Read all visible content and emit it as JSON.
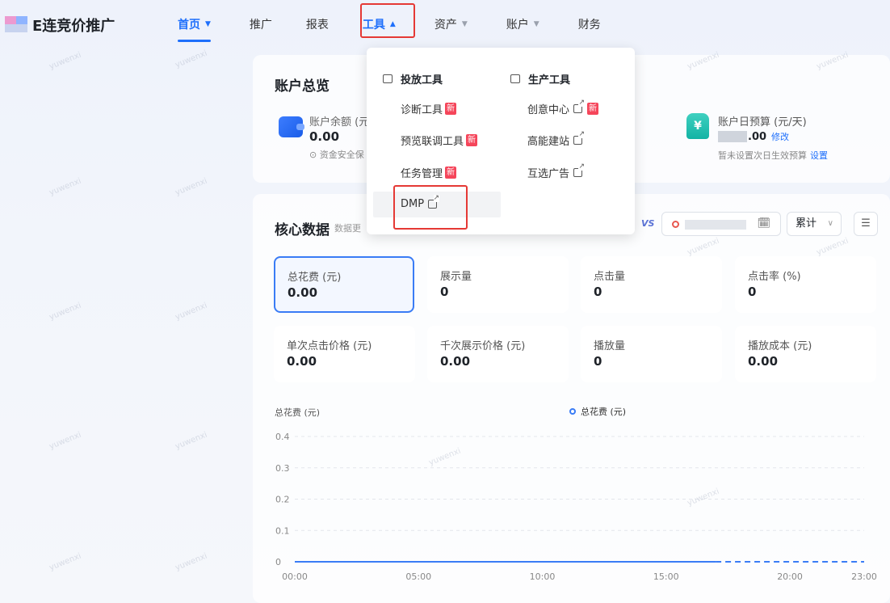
{
  "app": {
    "brand": "E连竞价推广"
  },
  "nav": {
    "items": [
      {
        "label": "首页",
        "caret": "▼"
      },
      {
        "label": "推广"
      },
      {
        "label": "报表"
      },
      {
        "label": "工具",
        "caret": "▲"
      },
      {
        "label": "资产",
        "caret": "▼"
      },
      {
        "label": "账户",
        "caret": "▼"
      },
      {
        "label": "财务"
      }
    ]
  },
  "overview": {
    "title": "账户总览",
    "balance_label": "账户余额 (元",
    "balance_value": "0.00",
    "balance_note": "⊙ 资金安全保",
    "budget_icon": "¥",
    "budget_label": "账户日预算 (元/天)",
    "budget_value": ".00",
    "budget_modify": "修改",
    "budget_note": "暂未设置次日生效预算",
    "budget_set": "设置"
  },
  "core": {
    "title": "核心数据",
    "subtitle": "数据更",
    "vs": "VS",
    "calendar_icon": "🗓",
    "accumulate": "累计",
    "accumulate_caret": "∨",
    "list_icon": "☰",
    "metrics": [
      {
        "label": "总花费 (元)",
        "value": "0.00"
      },
      {
        "label": "展示量",
        "value": "0"
      },
      {
        "label": "点击量",
        "value": "0"
      },
      {
        "label": "点击率 (%)",
        "value": "0"
      },
      {
        "label": "单次点击价格 (元)",
        "value": "0.00"
      },
      {
        "label": "千次展示价格 (元)",
        "value": "0.00"
      },
      {
        "label": "播放量",
        "value": "0"
      },
      {
        "label": "播放成本 (元)",
        "value": "0.00"
      }
    ]
  },
  "chart_data": {
    "type": "line",
    "ylabel": "总花费 (元)",
    "x_ticks": [
      "00:00",
      "05:00",
      "10:00",
      "15:00",
      "20:00",
      "23:00"
    ],
    "y_ticks": [
      "0.4",
      "0.3",
      "0.2",
      "0.1",
      "0"
    ],
    "ylim": [
      0,
      0.4
    ],
    "xlim": [
      0,
      23
    ],
    "series": [
      {
        "name": "总花费 (元)",
        "values": [
          [
            0,
            0
          ],
          [
            17,
            0
          ]
        ],
        "projected": [
          [
            17,
            0
          ],
          [
            23,
            0
          ]
        ]
      }
    ]
  },
  "tools_menu": {
    "col1_title": "投放工具",
    "col2_title": "生产工具",
    "new_tag": "新",
    "col1": [
      "诊断工具",
      "预览联调工具",
      "任务管理",
      "DMP"
    ],
    "col2": [
      "创意中心",
      "高能建站",
      "互选广告"
    ]
  },
  "watermark": "yuwenxi"
}
